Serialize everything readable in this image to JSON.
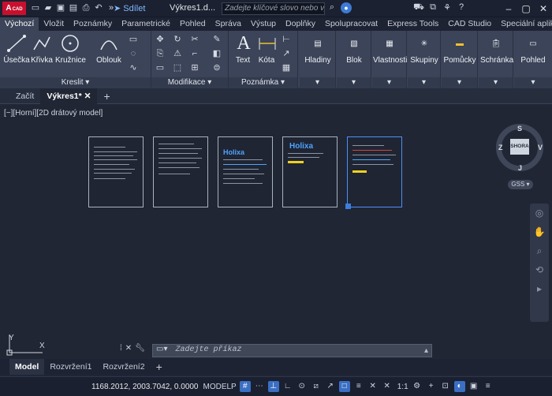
{
  "app": {
    "logo": "A",
    "logo_sub": "CAD",
    "share_label": "Sdílet",
    "document_title": "Výkres1.d...",
    "search_placeholder": "Zadejte klíčové slovo nebo výraz."
  },
  "ribbon_tabs": [
    "Výchozí",
    "Vložit",
    "Poznámky",
    "Parametrické",
    "Pohled",
    "Správa",
    "Výstup",
    "Doplňky",
    "Spolupracovat",
    "Express Tools",
    "CAD Studio",
    "Speciální aplikace"
  ],
  "draw_tools": {
    "line": "Úsečka",
    "polyline": "Křivka",
    "circle": "Kružnice",
    "arc": "Oblouk"
  },
  "panels": {
    "draw": "Kreslit",
    "modify": "Modifikace",
    "annotation": "Poznámka"
  },
  "annotation_tools": {
    "text": "Text",
    "dimension": "Kóta"
  },
  "big_tools": [
    "Hladiny",
    "Blok",
    "Vlastnosti",
    "Skupiny",
    "Pomůcky",
    "Schránka",
    "Pohled"
  ],
  "doc_tabs": {
    "start": "Začít",
    "drawing": "Výkres1*",
    "add": "+"
  },
  "viewport_label": "[−][Horní][2D drátový model]",
  "viewcube": {
    "face": "SHORA",
    "north": "S",
    "south": "J",
    "east": "V",
    "west": "Z",
    "wcs": "GSS"
  },
  "pages": [
    {
      "heading": ""
    },
    {
      "heading": ""
    },
    {
      "heading": "Holixa"
    },
    {
      "heading": "Holixa"
    },
    {
      "heading": ""
    }
  ],
  "ucs": {
    "x": "X",
    "y": "Y"
  },
  "command_placeholder": "Zadejte příkaz",
  "layout_tabs": [
    "Model",
    "Rozvržení1",
    "Rozvržení2",
    "+"
  ],
  "status": {
    "coordinates": "1168.2012, 2003.7042, 0.0000",
    "space": "MODELP",
    "scale": "1:1"
  }
}
